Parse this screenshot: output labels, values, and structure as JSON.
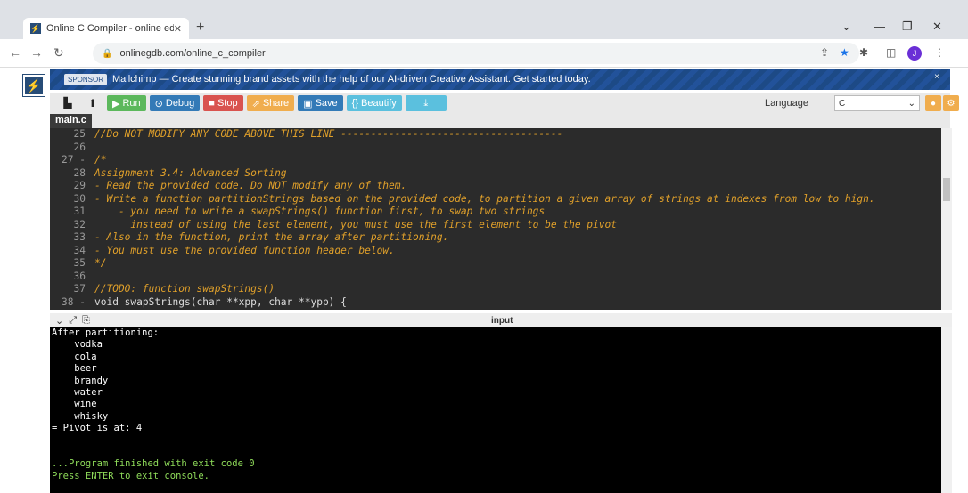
{
  "browser": {
    "tab_title": "Online C Compiler - online editor",
    "tab_close": "✕",
    "new_tab": "+",
    "url": "onlinegdb.com/online_c_compiler",
    "profile_initial": "J"
  },
  "sponsor": {
    "tag": "SPONSOR",
    "text": "Mailchimp — Create stunning brand assets with the help of our AI-driven Creative Assistant. Get started today.",
    "close": "×"
  },
  "toolbar": {
    "run_label": "Run",
    "debug_label": "Debug",
    "stop_label": "Stop",
    "share_label": "Share",
    "save_label": "Save",
    "beautify_label": "{} Beautify",
    "language_label": "Language",
    "language_value": "C"
  },
  "file_tab": "main.c",
  "code_lines": [
    {
      "n": "25",
      "text": "//Do NOT MODIFY ANY CODE ABOVE THIS LINE -------------------------------------",
      "style": "comment"
    },
    {
      "n": "26",
      "text": "",
      "style": "comment"
    },
    {
      "n": "27 -",
      "text": "/*",
      "style": "comment"
    },
    {
      "n": "28",
      "text": "Assignment 3.4: Advanced Sorting",
      "style": "comment"
    },
    {
      "n": "29",
      "text": "- Read the provided code. Do NOT modify any of them.",
      "style": "comment"
    },
    {
      "n": "30",
      "text": "- Write a function partitionStrings based on the provided code, to partition a given array of strings at indexes from low to high.",
      "style": "comment"
    },
    {
      "n": "31",
      "text": "    - you need to write a swapStrings() function first, to swap two strings",
      "style": "comment"
    },
    {
      "n": "32",
      "text": "      instead of using the last element, you must use the first element to be the pivot",
      "style": "comment"
    },
    {
      "n": "33",
      "text": "- Also in the function, print the array after partitioning.",
      "style": "comment"
    },
    {
      "n": "34",
      "text": "- You must use the provided function header below.",
      "style": "comment"
    },
    {
      "n": "35",
      "text": "*/",
      "style": "comment"
    },
    {
      "n": "36",
      "text": "",
      "style": "comment"
    },
    {
      "n": "37",
      "text": "//TODO: function swapStrings()",
      "style": "comment"
    },
    {
      "n": "38 -",
      "text": "void swapStrings(char **xpp, char **ypp) {",
      "style": "plain"
    }
  ],
  "io": {
    "label": "input"
  },
  "console_lines": [
    {
      "text": "After partitioning:",
      "color": "white"
    },
    {
      "text": "    vodka",
      "color": "white"
    },
    {
      "text": "    cola",
      "color": "white"
    },
    {
      "text": "    beer",
      "color": "white"
    },
    {
      "text": "    brandy",
      "color": "white"
    },
    {
      "text": "    water",
      "color": "white"
    },
    {
      "text": "    wine",
      "color": "white"
    },
    {
      "text": "    whisky",
      "color": "white"
    },
    {
      "text": "= Pivot is at: 4",
      "color": "white"
    },
    {
      "text": "",
      "color": "white"
    },
    {
      "text": "",
      "color": "white"
    },
    {
      "text": "...Program finished with exit code 0",
      "color": "green"
    },
    {
      "text": "Press ENTER to exit console.",
      "color": "green"
    }
  ]
}
